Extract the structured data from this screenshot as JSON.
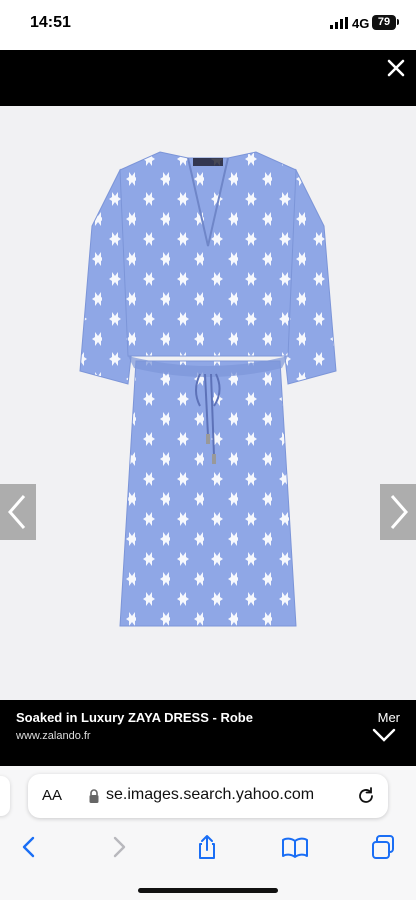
{
  "status_bar": {
    "time": "14:51",
    "network": "4G",
    "battery": "79"
  },
  "viewer": {
    "close_icon": "close-icon",
    "prev_icon": "chevron-left-icon",
    "next_icon": "chevron-right-icon"
  },
  "caption": {
    "title": "Soaked in Luxury ZAYA DRESS - Robe",
    "source": "www.zalando.fr",
    "more_label": "Mer"
  },
  "browser": {
    "text_size_label": "AA",
    "url": "se.images.search.yahoo.com",
    "toolbar": [
      "back-icon",
      "forward-icon",
      "share-icon",
      "bookmarks-icon",
      "tabs-icon"
    ]
  },
  "colors": {
    "dress": "#8fa7e6",
    "dress_shadow": "#7c95d8",
    "pattern": "#ffffff",
    "accent": "#1a6ef5",
    "viewer_background": "#000000"
  }
}
